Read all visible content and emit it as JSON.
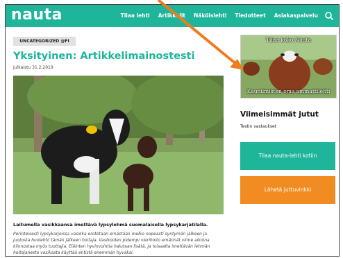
{
  "header": {
    "logo": "nauta",
    "nav": [
      "Tilaa lehti",
      "Artikkelit",
      "Näköislehti",
      "Tiedotteet",
      "Asiakaspalvelu"
    ]
  },
  "article": {
    "category": "UNCATEGORIZED @FI",
    "title": "Yksityinen: Artikkelimainostesti",
    "date": "Julkaistu 31.2.2019",
    "caption": "Laitumella vasikkaansa imettävä lypsylehmä suomalaisella lypsykarjatilalla.",
    "body": "Perinteisesti lypsykarjoissa vasikka erotetaan emästään melko nopeasti syntymän jälkeen ja juotosta huolehtii tämän jälkeen hoitaja. Vasikoiden pidempi vierihoito emännät viime aikoina kiinnostaa myös tuottajia. Eläinten hyvinvointia halutaan lisätä, ja toisaalta imettävän lehmän hoitajanesta vasikasta käyttää entistä enemmän hyväksi."
  },
  "sidebar": {
    "ad_top": "Tilaa koko Nauta",
    "ad_bottom": "Kauniimisten oma ammattilehti",
    "recent_title": "Viimeisimmät jutut",
    "recent_link": "Testin vastaukset",
    "subscribe_button": "Tilaa nauta-lehti kotiin",
    "tip_button": "Lähetä juttuvinkki"
  },
  "colors": {
    "brand": "#1eb59b",
    "accent": "#f08c21"
  },
  "icons": {
    "search": "search-icon"
  }
}
